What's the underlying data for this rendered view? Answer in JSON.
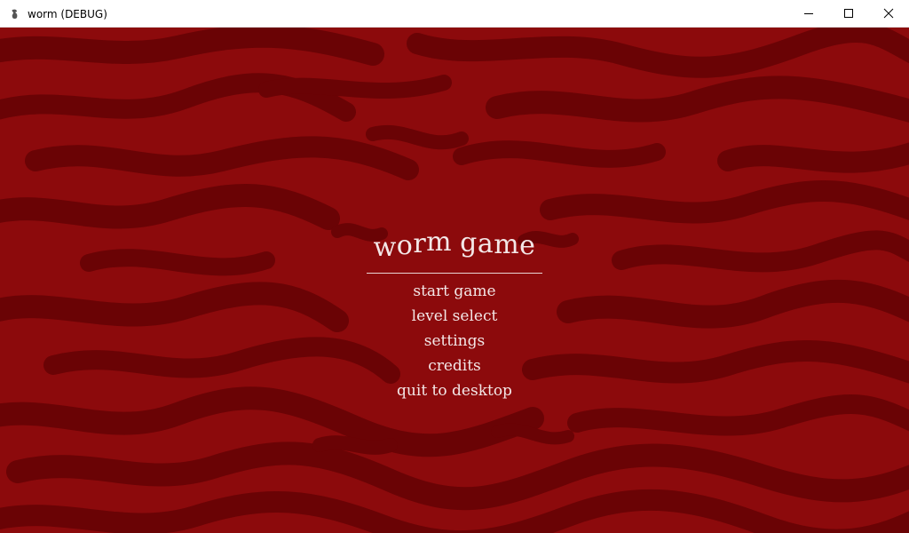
{
  "window": {
    "title": "worm (DEBUG)",
    "controls": {
      "minimize": "minimize-icon",
      "maximize": "maximize-icon",
      "close": "close-icon"
    }
  },
  "menu": {
    "title_letters": [
      "w",
      "o",
      "r",
      "m",
      " ",
      "g",
      "a",
      "m",
      "e"
    ],
    "items": [
      {
        "label": "start game"
      },
      {
        "label": "level select"
      },
      {
        "label": "settings"
      },
      {
        "label": "credits"
      },
      {
        "label": "quit to desktop"
      }
    ]
  },
  "colors": {
    "background": "#8c0a0c",
    "camo_dark": "#6a0305",
    "text": "#f3e7e7"
  }
}
